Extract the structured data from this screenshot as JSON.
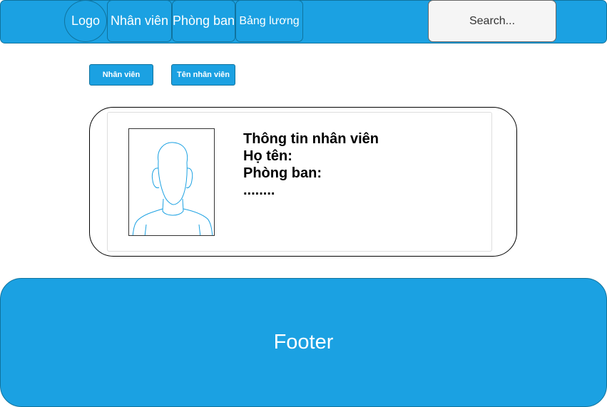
{
  "navbar": {
    "logo": "Logo",
    "items": [
      "Nhân viên",
      "Phòng ban",
      "Bảng lương"
    ],
    "search_placeholder": "Search..."
  },
  "actions": {
    "employee_button": "Nhân viên",
    "employee_name_button": "Tên nhân viên"
  },
  "card": {
    "title": "Thông tin nhân viên",
    "name_label": "Họ tên:",
    "department_label": "Phòng ban:",
    "more": "........",
    "photo_icon": "person-avatar-icon"
  },
  "footer": {
    "label": "Footer"
  },
  "colors": {
    "accent": "#1ba1e2",
    "border": "#10739e"
  }
}
